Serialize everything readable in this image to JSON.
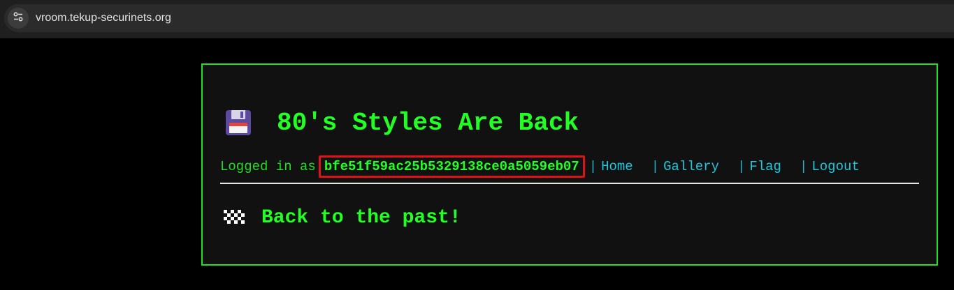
{
  "browser": {
    "url": "vroom.tekup-securinets.org",
    "site_info_icon": "tune-icon"
  },
  "page": {
    "title_icon": "floppy-disk-icon",
    "title": "80's Styles Are Back",
    "logged_in_label": "Logged in as",
    "user_id": "bfe51f59ac25b5329138ce0a5059eb07",
    "nav": [
      {
        "label": "Home"
      },
      {
        "label": "Gallery"
      },
      {
        "label": "Flag"
      },
      {
        "label": "Logout"
      }
    ],
    "separator": "|",
    "subtitle_icon": "checkered-flag-icon",
    "subtitle": "Back to the past!"
  },
  "colors": {
    "background": "#000000",
    "panel": "#111111",
    "neon_green": "#22ff22",
    "link_cyan": "#1fc8dc",
    "highlight_red": "#d21818"
  }
}
